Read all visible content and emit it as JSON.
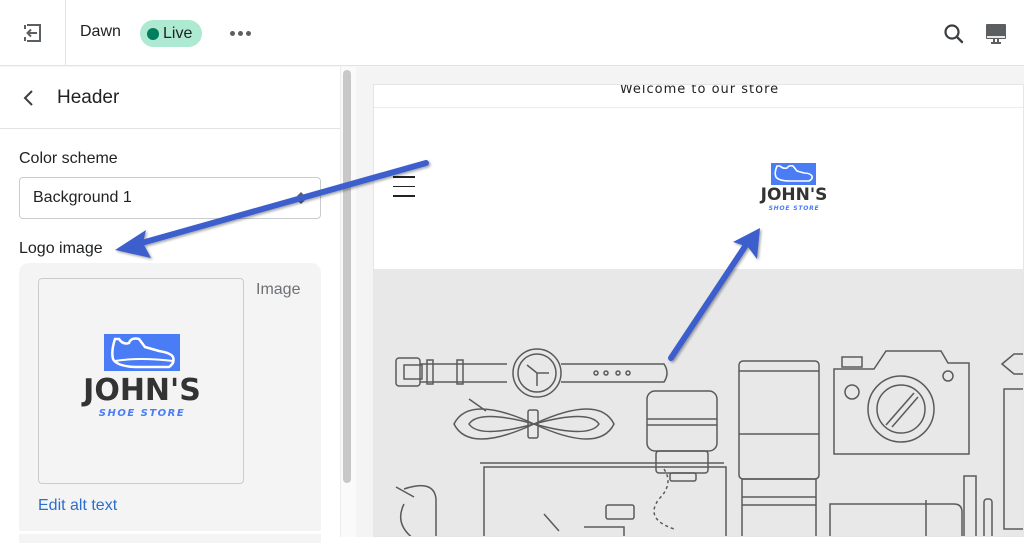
{
  "topbar": {
    "theme_name": "Dawn",
    "status_badge": "Live",
    "colors": {
      "live_badge_bg": "#aee9d1",
      "live_dot": "#007f5f"
    }
  },
  "panel": {
    "title": "Header",
    "color_scheme": {
      "label": "Color scheme",
      "value": "Background 1"
    },
    "logo_image": {
      "label": "Logo image",
      "image_label": "Image",
      "edit_alt_text": "Edit alt text",
      "logo_title": "JOHN'S",
      "logo_subtitle": "SHOE STORE"
    }
  },
  "preview": {
    "announcement": "Welcome to our store",
    "logo_title": "JOHN'S",
    "logo_subtitle": "SHOE STORE",
    "colors": {
      "logo_blue": "#4a7cf5",
      "annotation_arrow": "#3d5fce"
    }
  }
}
